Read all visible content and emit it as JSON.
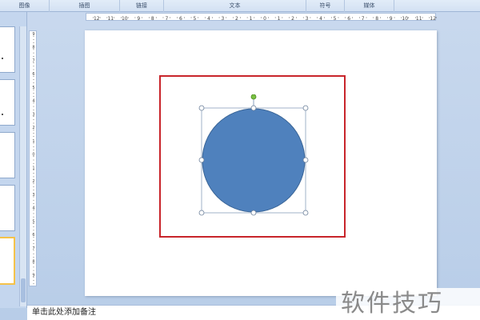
{
  "ribbon": {
    "groups": [
      "图像",
      "插图",
      "链接",
      "文本",
      "符号",
      "媒体"
    ]
  },
  "ruler": {
    "labels": [
      "12",
      "11",
      "10",
      "9",
      "8",
      "7",
      "6",
      "5",
      "4",
      "3",
      "2",
      "1",
      "0",
      "1",
      "2",
      "3",
      "4",
      "5",
      "6",
      "7",
      "8",
      "9",
      "10",
      "11",
      "12"
    ]
  },
  "slide": {
    "frame_color": "#c8252b",
    "shape_fill": "#4f81bd",
    "rotate_handle_color": "#7ac143"
  },
  "notes": {
    "placeholder": "单击此处添加备注"
  },
  "watermark": {
    "text": "软件技巧"
  }
}
